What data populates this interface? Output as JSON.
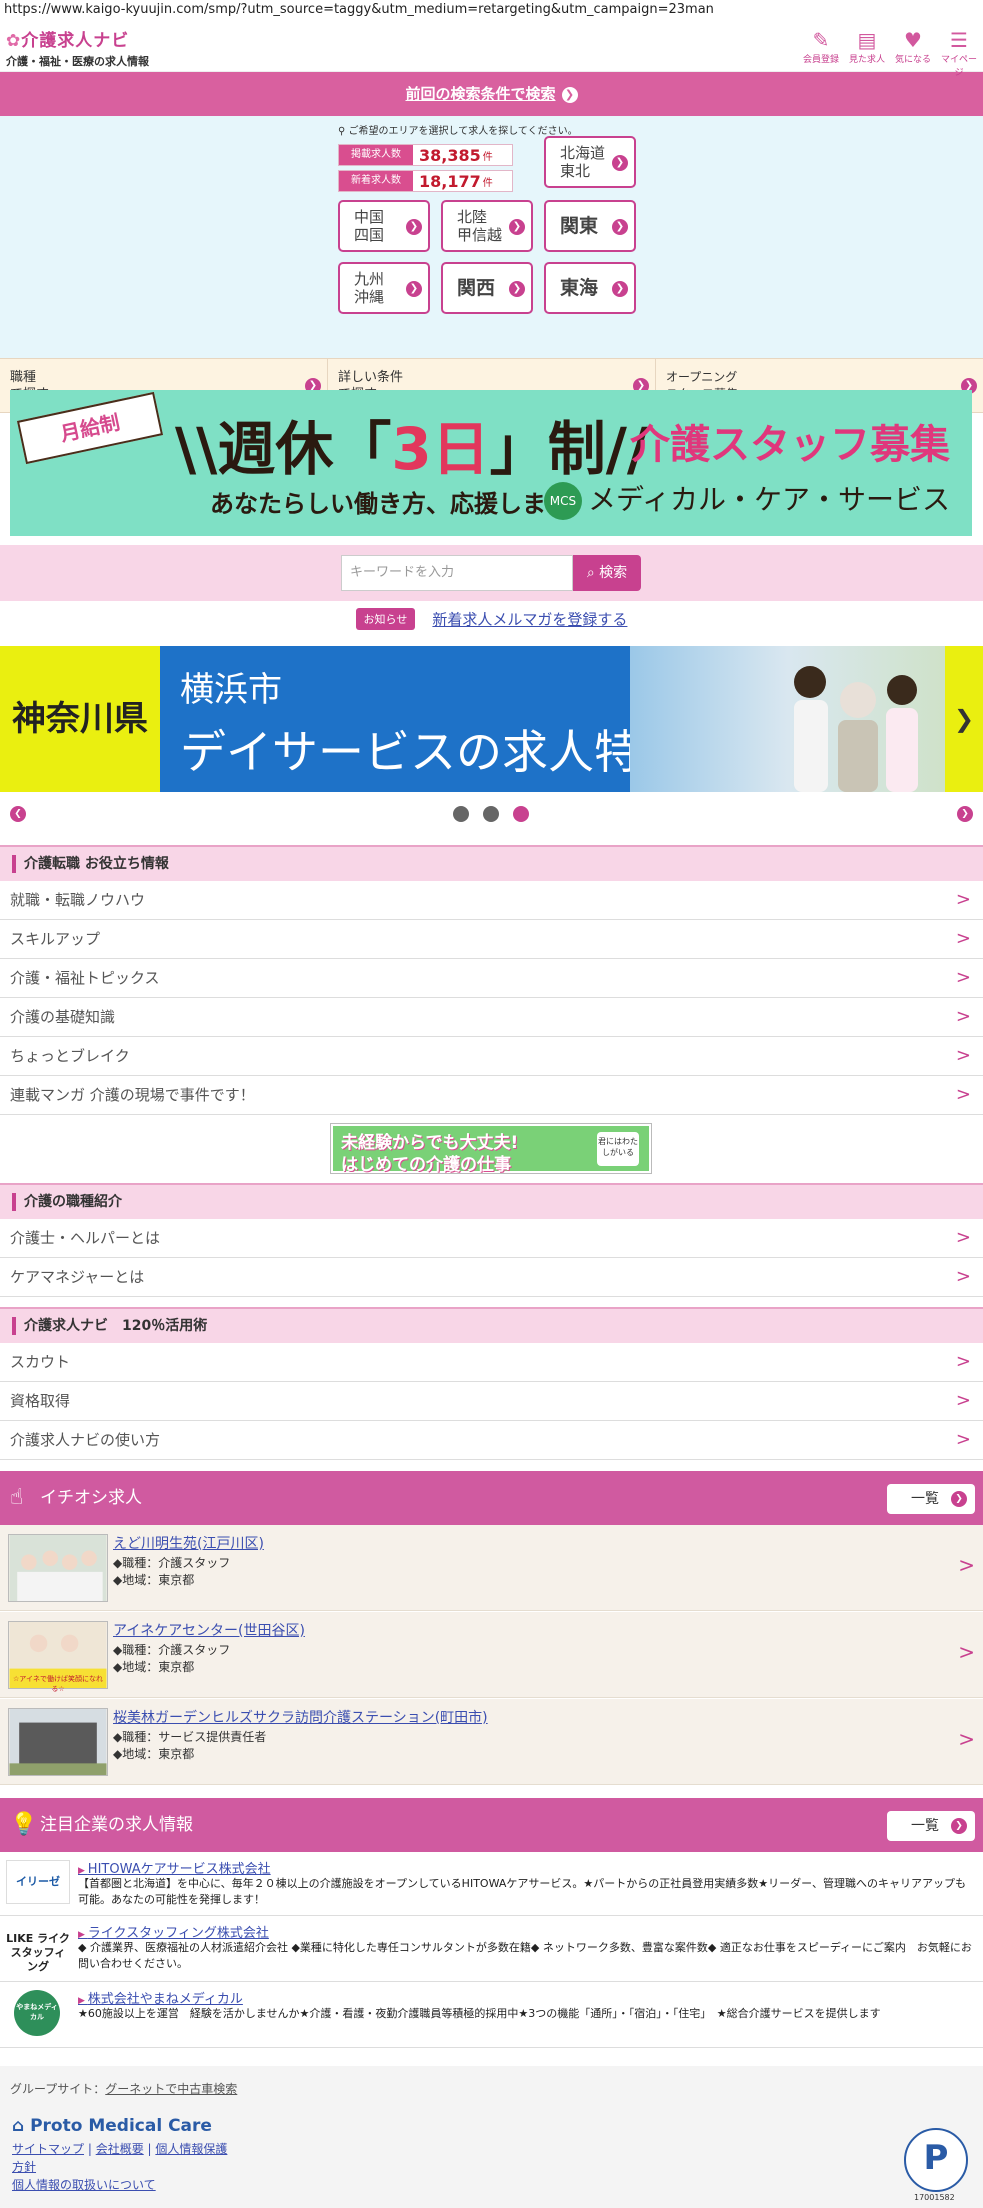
{
  "browser": {
    "url": "https://www.kaigo-kyuujin.com/smp/?utm_source=taggy&utm_medium=retargeting&utm_campaign=23man"
  },
  "header": {
    "logo_title": "介護求人ナビ",
    "logo_sub": "介護・福祉・医療の求人情報",
    "icons": [
      {
        "label": "会員登録",
        "icon": "pencil-icon"
      },
      {
        "label": "見た求人",
        "icon": "clipboard-icon"
      },
      {
        "label": "気になる",
        "icon": "heart-icon"
      },
      {
        "label": "マイページ",
        "icon": "mypage-icon"
      }
    ]
  },
  "prev_search": {
    "label": "前回の検索条件で検索"
  },
  "area": {
    "note": "ご希望のエリアを選択して求人を探してください。",
    "stats": [
      {
        "label": "掲載求人数",
        "value": "38,385",
        "unit": "件"
      },
      {
        "label": "新着求人数",
        "value": "18,177",
        "unit": "件"
      }
    ],
    "regions": [
      "北海道\n東北",
      "中国\n四国",
      "北陸\n甲信越",
      "関東",
      "九州\n沖縄",
      "関西",
      "東海"
    ]
  },
  "search_by": [
    {
      "label": "職種\nで探す"
    },
    {
      "label": "詳しい条件\nで探す"
    },
    {
      "label": "オープニング\nスタッフ募集"
    }
  ],
  "banner": {
    "ribbon": "月給制",
    "main_pre": "\\\\週休「",
    "main_red": "3日",
    "main_post": "」制//",
    "sub": "あなたらしい働き方、応援します!",
    "recruit": "介護スタッフ募集",
    "company": "メディカル・ケア・サービス",
    "company_badge": "MCS"
  },
  "keyword": {
    "placeholder": "キーワードを入力",
    "button": "検索"
  },
  "notice": {
    "tag": "お知らせ",
    "link": "新着求人メルマガを登録する"
  },
  "feature": {
    "pref": "神奈川県",
    "city": "横浜市",
    "title": "デイサービスの求人特集"
  },
  "carousel": {
    "active_index": 2,
    "count": 3
  },
  "sections": {
    "tips": {
      "title": "介護転職 お役立ち情報",
      "items": [
        "就職・転職ノウハウ",
        "スキルアップ",
        "介護・福祉トピックス",
        "介護の基礎知識",
        "ちょっとブレイク",
        "連載マンガ 介護の現場で事件です！"
      ]
    },
    "mikeiken": {
      "line1": "未経験からでも大丈夫!",
      "line2": "はじめての介護の仕事",
      "badge": "君にはわたしがいる"
    },
    "jobtypes": {
      "title": "介護の職種紹介",
      "items": [
        "介護士・ヘルパーとは",
        "ケアマネジャーとは"
      ]
    },
    "howto": {
      "title": "介護求人ナビ　120％活用術",
      "items": [
        "スカウト",
        "資格取得",
        "介護求人ナビの使い方"
      ]
    }
  },
  "recommended": {
    "title": "イチオシ求人",
    "more": "一覧",
    "jobs": [
      {
        "name": "えど川明生苑(江戸川区)",
        "role": "◆職種：介護スタッフ",
        "area": "◆地域：東京都"
      },
      {
        "name": "アイネケアセンター(世田谷区)",
        "role": "◆職種：介護スタッフ",
        "area": "◆地域：東京都",
        "thumb_text": "☆アイネで働けば笑顔になれる☆"
      },
      {
        "name": "桜美林ガーデンヒルズサクラ訪問介護ステーション(町田市)",
        "role": "◆職種：サービス提供責任者",
        "area": "◆地域：東京都"
      }
    ]
  },
  "companies": {
    "title": "注目企業の求人情報",
    "more": "一覧",
    "items": [
      {
        "logo": "イリーゼ",
        "name": "HITOWAケアサービス株式会社",
        "desc": "【首都圏と北海道】を中心に、毎年２０棟以上の介護施設をオープンしているHITOWAケアサービス。★パートからの正社員登用実績多数★リーダー、管理職へのキャリアアップも可能。あなたの可能性を発揮します！"
      },
      {
        "logo": "LIKE ライク スタッフィング",
        "name": "ライクスタッフィング株式会社",
        "desc": "◆ 介護業界、医療福祉の人材派遣紹介会社 ◆業種に特化した専任コンサルタントが多数在籍◆ ネットワーク多数、豊富な案件数◆ 適正なお仕事をスピーディーにご案内　お気軽にお問い合わせください。"
      },
      {
        "logo": "やまねメディカル",
        "name": "株式会社やまねメディカル",
        "desc": "★60施設以上を運営　経験を活かしませんか★介護・看護・夜勤介護職員等積極的採用中★3つの機能「通所」・「宿泊」・「住宅」　★総合介護サービスを提供します"
      }
    ]
  },
  "footer": {
    "group_label": "グループサイト：",
    "group_link": "グーネットで中古車検索",
    "brand": "Proto Medical Care",
    "links_line1": [
      "サイトマップ",
      "会社概要",
      "個人情報保護"
    ],
    "links_line2": "方針",
    "links_line3": "個人情報の取扱いについて",
    "pmark_label": "P",
    "pmark_number": "17001582"
  }
}
